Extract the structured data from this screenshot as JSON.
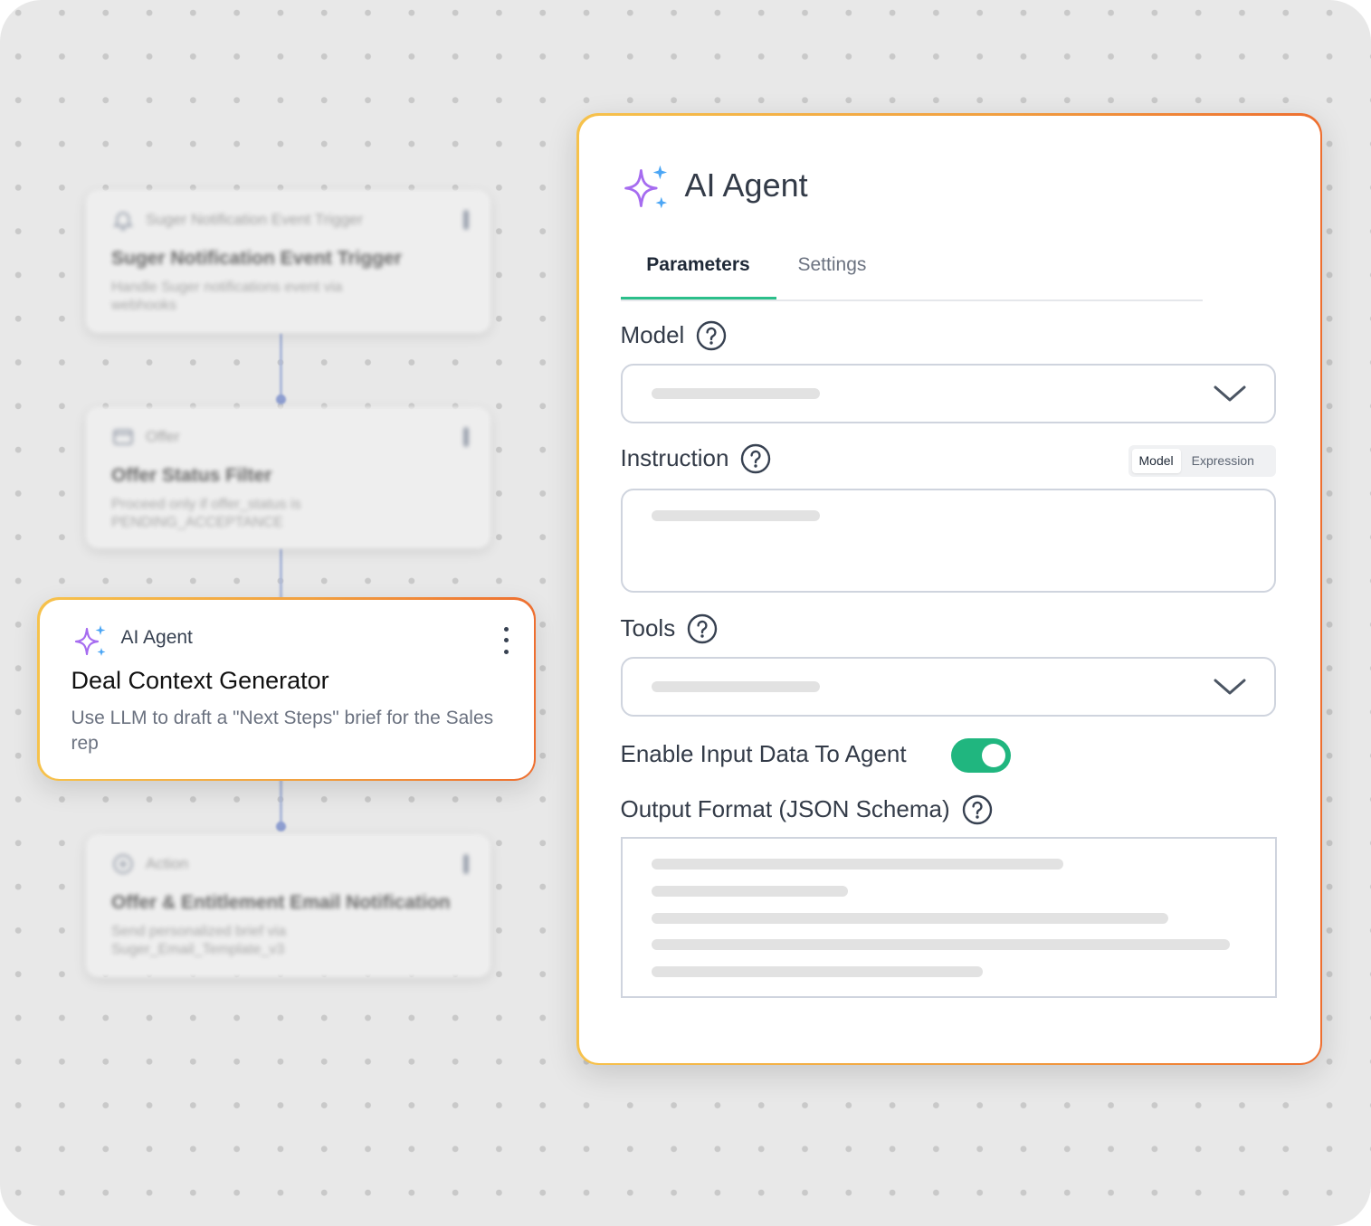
{
  "workflow": {
    "nodes": [
      {
        "type_label": "Suger Notification Event Trigger",
        "title": "Suger Notification Event Trigger",
        "description": "Handle Suger notifications event via webhooks",
        "icon": "bell-icon"
      },
      {
        "type_label": "Offer",
        "title": "Offer Status Filter",
        "description": "Proceed only if offer_status is PENDING_ACCEPTANCE",
        "icon": "mail-icon"
      },
      {
        "type_label": "AI Agent",
        "title": "Deal Context Generator",
        "description": "Use LLM to draft a \"Next Steps\" brief for the Sales rep",
        "icon": "sparkle-icon"
      },
      {
        "type_label": "Action",
        "title": "Offer & Entitlement Email Notification",
        "description": "Send personalized brief via Suger_Email_Template_v3",
        "icon": "plus-circle-icon"
      }
    ]
  },
  "panel": {
    "title": "AI Agent",
    "tabs": [
      {
        "label": "Parameters",
        "active": true
      },
      {
        "label": "Settings",
        "active": false
      }
    ],
    "fields": {
      "model_label": "Model",
      "instruction_label": "Instruction",
      "instruction_modes": [
        "Model",
        "Expression"
      ],
      "tools_label": "Tools",
      "enable_input_label": "Enable Input Data To Agent",
      "enable_input_on": true,
      "output_format_label": "Output Format (JSON Schema)"
    }
  },
  "colors": {
    "accent_green": "#20b67f",
    "card_border_start": "#f6c24c",
    "card_border_end": "#ee6f30",
    "sparkle_purple": "#a66cf0",
    "sparkle_blue": "#4ba6f5"
  }
}
